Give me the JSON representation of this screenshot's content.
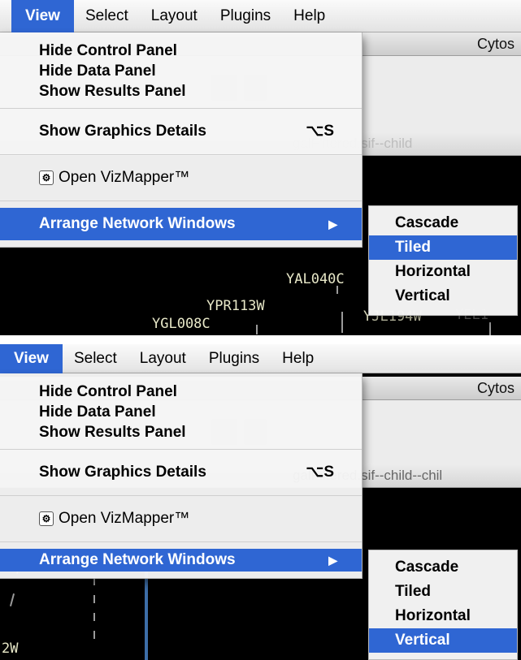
{
  "menubar": {
    "items": [
      "View",
      "Select",
      "Layout",
      "Plugins",
      "Help"
    ]
  },
  "background": {
    "window_title_top": "Cytos",
    "window_title_bottom": "Cytos",
    "network_title_top": "galFiltered.sif--child",
    "network_title_bottom": "galFiltered.sif--child--chil"
  },
  "view_menu": {
    "hide_control_panel": "Hide Control Panel",
    "hide_data_panel": "Hide Data Panel",
    "show_results_panel": "Show Results Panel",
    "show_graphics_details": "Show Graphics Details",
    "show_graphics_details_shortcut": "⌥S",
    "open_vizmapper": "Open VizMapper™",
    "arrange_network_windows": "Arrange Network Windows",
    "submenu_arrow": "▶"
  },
  "arrange_submenu": {
    "items": [
      "Cascade",
      "Tiled",
      "Horizontal",
      "Vertical"
    ],
    "selected_top": "Tiled",
    "selected_bottom": "Vertical"
  },
  "network_labels_top": [
    "YAL040C",
    "YPR113W",
    "YGL008C",
    "YJL194W",
    "YEL1"
  ],
  "network_labels_bottom": [
    "2W"
  ],
  "colors": {
    "menu_highlight": "#2f66d3",
    "canvas_background": "#000000"
  },
  "icons": {
    "vizmapper": "vizmapper-icon",
    "submenu_arrow": "chevron-right-icon"
  }
}
